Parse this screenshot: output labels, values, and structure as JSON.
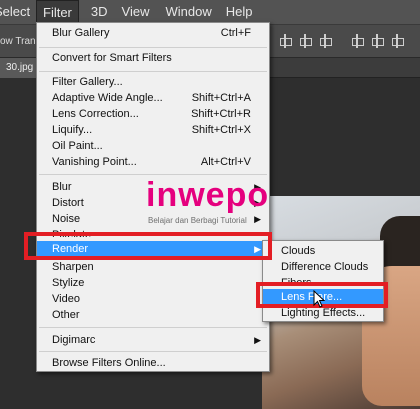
{
  "menubar": {
    "items": [
      "Select",
      "Filter",
      "3D",
      "View",
      "Window",
      "Help"
    ]
  },
  "optbar": {
    "left_text": "ow Transf"
  },
  "doctab": {
    "label": "30.jpg"
  },
  "watermark": {
    "brand": "inwepo",
    "tagline": "Belajar dan Berbagi Tutorial"
  },
  "filter_menu": {
    "items": [
      {
        "label": "Blur Gallery",
        "shortcut": "Ctrl+F"
      },
      {
        "label": "Convert for Smart Filters",
        "shortcut": ""
      },
      {
        "label": "Filter Gallery...",
        "shortcut": ""
      },
      {
        "label": "Adaptive Wide Angle...",
        "shortcut": "Shift+Ctrl+A"
      },
      {
        "label": "Lens Correction...",
        "shortcut": "Shift+Ctrl+R"
      },
      {
        "label": "Liquify...",
        "shortcut": "Shift+Ctrl+X"
      },
      {
        "label": "Oil Paint...",
        "shortcut": ""
      },
      {
        "label": "Vanishing Point...",
        "shortcut": "Alt+Ctrl+V"
      },
      {
        "label": "Blur",
        "shortcut": ""
      },
      {
        "label": "Distort",
        "shortcut": ""
      },
      {
        "label": "Noise",
        "shortcut": ""
      },
      {
        "label": "Pixelate",
        "shortcut": ""
      },
      {
        "label": "Render",
        "shortcut": ""
      },
      {
        "label": "Sharpen",
        "shortcut": ""
      },
      {
        "label": "Stylize",
        "shortcut": ""
      },
      {
        "label": "Video",
        "shortcut": ""
      },
      {
        "label": "Other",
        "shortcut": ""
      },
      {
        "label": "Digimarc",
        "shortcut": ""
      },
      {
        "label": "Browse Filters Online...",
        "shortcut": ""
      }
    ]
  },
  "render_submenu": {
    "items": [
      "Clouds",
      "Difference Clouds",
      "Fibers...",
      "Lens Flare...",
      "Lighting Effects..."
    ]
  },
  "colors": {
    "highlight": "#3399ff",
    "annotation_red": "#e31e24",
    "brand_pink": "#e5007e"
  }
}
